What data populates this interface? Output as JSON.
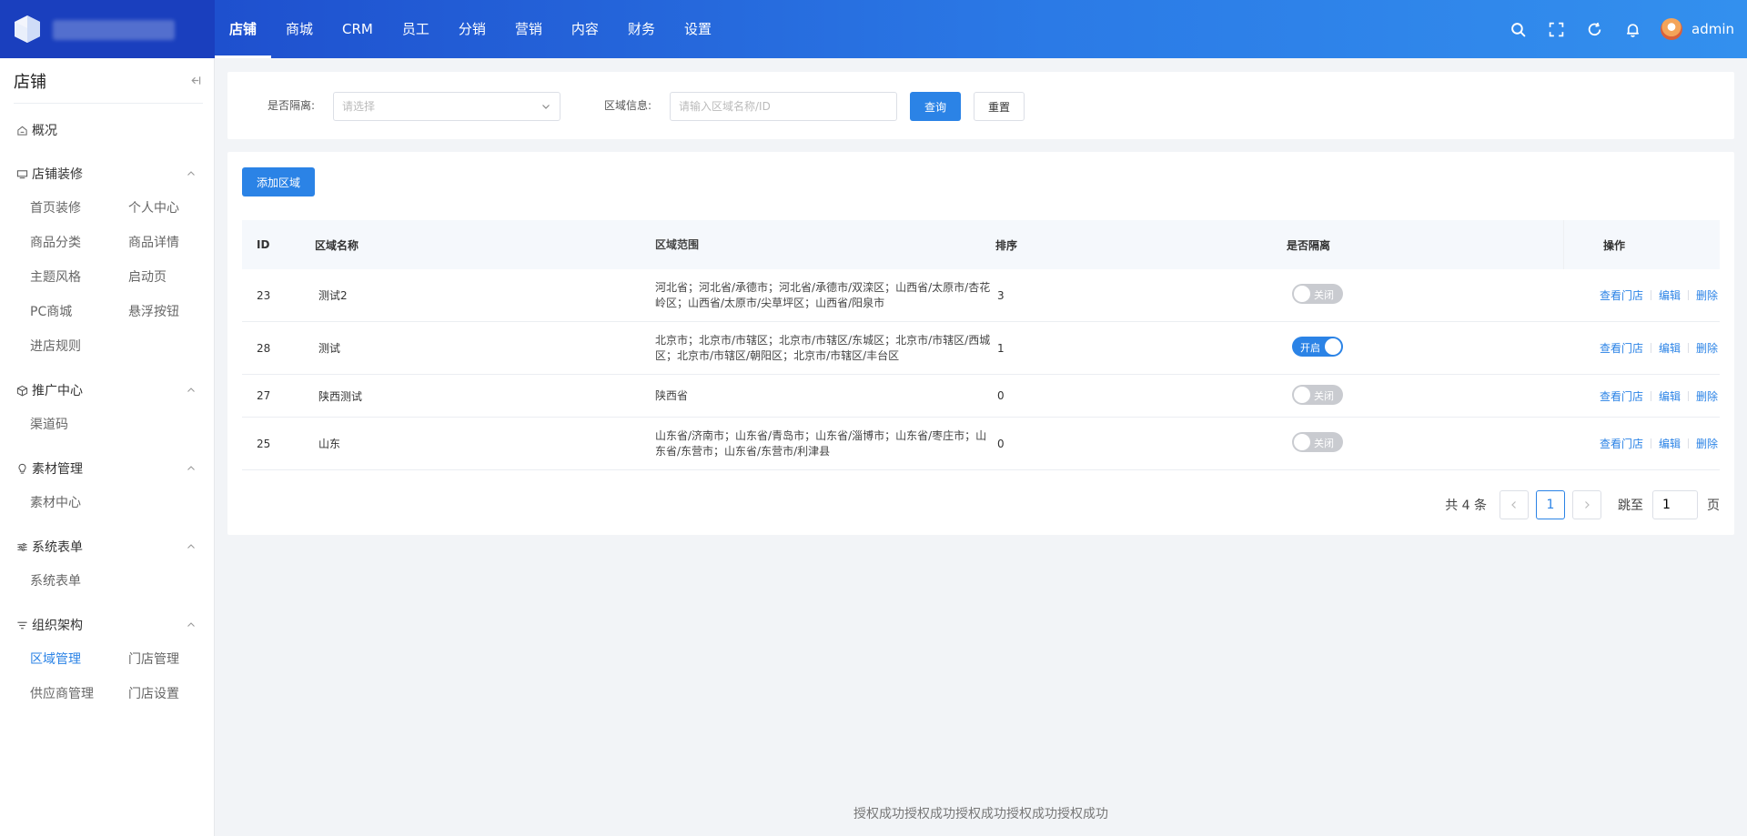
{
  "topbar": {
    "nav": [
      "店铺",
      "商城",
      "CRM",
      "员工",
      "分销",
      "营销",
      "内容",
      "财务",
      "设置"
    ],
    "active_nav": "店铺",
    "username": "admin"
  },
  "sidebar": {
    "title": "店铺",
    "overview": "概况",
    "groups": [
      {
        "label": "店铺装修",
        "icon": "monitor-icon",
        "items": [
          "首页装修",
          "个人中心",
          "商品分类",
          "商品详情",
          "主题风格",
          "启动页",
          "PC商城",
          "悬浮按钮",
          "进店规则"
        ]
      },
      {
        "label": "推广中心",
        "icon": "cube-icon",
        "items": [
          "渠道码"
        ]
      },
      {
        "label": "素材管理",
        "icon": "bulb-icon",
        "items": [
          "素材中心"
        ]
      },
      {
        "label": "系统表单",
        "icon": "sliders-icon",
        "items": [
          "系统表单"
        ]
      },
      {
        "label": "组织架构",
        "icon": "filter-icon",
        "items": [
          "区域管理",
          "门店管理",
          "供应商管理",
          "门店设置"
        ]
      }
    ],
    "active_item": "区域管理"
  },
  "filter": {
    "isolate_label": "是否隔离:",
    "isolate_placeholder": "请选择",
    "region_label": "区域信息:",
    "region_placeholder": "请输入区域名称/ID",
    "query_button": "查询",
    "reset_button": "重置"
  },
  "list": {
    "add_button": "添加区域",
    "headers": {
      "id": "ID",
      "name": "区域名称",
      "range": "区域范围",
      "sort": "排序",
      "isolate": "是否隔离",
      "op": "操作"
    },
    "rows": [
      {
        "id": "23",
        "name": "测试2",
        "range": "河北省；河北省/承德市；河北省/承德市/双滦区；山西省/太原市/杏花岭区；山西省/太原市/尖草坪区；山西省/阳泉市",
        "sort": "3",
        "isolate": false,
        "toggle_text": "关闭"
      },
      {
        "id": "28",
        "name": "测试",
        "range": "北京市；北京市/市辖区；北京市/市辖区/东城区；北京市/市辖区/西城区；北京市/市辖区/朝阳区；北京市/市辖区/丰台区",
        "sort": "1",
        "isolate": true,
        "toggle_text": "开启"
      },
      {
        "id": "27",
        "name": "陕西测试",
        "range": "陕西省",
        "sort": "0",
        "isolate": false,
        "toggle_text": "关闭"
      },
      {
        "id": "25",
        "name": "山东",
        "range": "山东省/济南市；山东省/青岛市；山东省/淄博市；山东省/枣庄市；山东省/东营市；山东省/东营市/利津县",
        "sort": "0",
        "isolate": false,
        "toggle_text": "关闭"
      }
    ],
    "ops": {
      "view": "查看门店",
      "edit": "编辑",
      "delete": "删除"
    }
  },
  "pager": {
    "total": "共 4 条",
    "current": "1",
    "jump_label": "跳至",
    "jump_value": "1",
    "page_suffix": "页"
  },
  "footer": "授权成功授权成功授权成功授权成功授权成功",
  "colors": {
    "primary": "#2b83e6",
    "topbar_start": "#1b45c8",
    "topbar_end": "#3390ee"
  }
}
